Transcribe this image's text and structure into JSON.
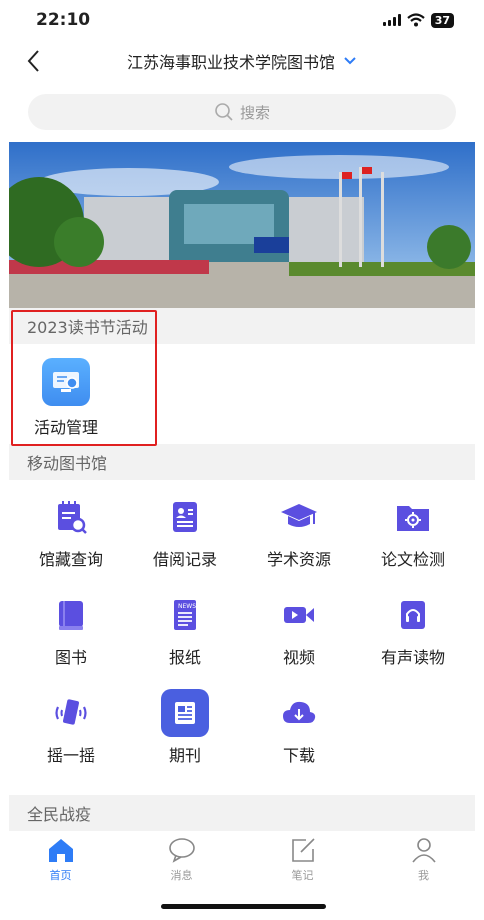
{
  "status_bar": {
    "time": "22:10",
    "battery": "37"
  },
  "nav": {
    "title": "江苏海事职业技术学院图书馆"
  },
  "search": {
    "placeholder": "搜索"
  },
  "reading_section": {
    "title": "2023读书节活动",
    "items": [
      {
        "label": "活动管理",
        "icon": "activity-management-icon"
      }
    ]
  },
  "mobile_library": {
    "title": "移动图书馆",
    "items": [
      {
        "label": "馆藏查询",
        "icon": "catalog-search-icon"
      },
      {
        "label": "借阅记录",
        "icon": "borrow-record-icon"
      },
      {
        "label": "学术资源",
        "icon": "graduation-cap-icon"
      },
      {
        "label": "论文检测",
        "icon": "paper-check-icon"
      },
      {
        "label": "图书",
        "icon": "book-icon"
      },
      {
        "label": "报纸",
        "icon": "newspaper-icon"
      },
      {
        "label": "视频",
        "icon": "video-icon"
      },
      {
        "label": "有声读物",
        "icon": "audiobook-icon"
      },
      {
        "label": "摇一摇",
        "icon": "shake-phone-icon"
      },
      {
        "label": "期刊",
        "icon": "journal-icon"
      },
      {
        "label": "下载",
        "icon": "cloud-download-icon"
      }
    ]
  },
  "third_section": {
    "title": "全民战疫"
  },
  "tabbar": {
    "items": [
      {
        "label": "首页",
        "icon": "home-icon",
        "active": true
      },
      {
        "label": "消息",
        "icon": "message-icon",
        "active": false
      },
      {
        "label": "笔记",
        "icon": "note-icon",
        "active": false
      },
      {
        "label": "我",
        "icon": "profile-icon",
        "active": false
      }
    ]
  },
  "colors": {
    "accent": "#2e7cf6",
    "icon_purple": "#5b4fe0",
    "highlight_red": "#e02020"
  }
}
